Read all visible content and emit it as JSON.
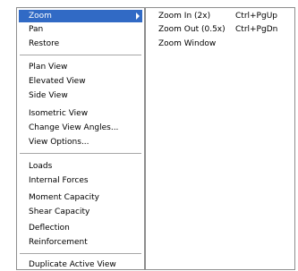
{
  "colors": {
    "selection_bg": "#316ac5",
    "selection_text": "#ffffff",
    "border": "#8e8e8e",
    "separator": "#a6a6a6"
  },
  "main_menu": {
    "items": [
      {
        "label": "Zoom",
        "has_submenu": true,
        "selected": true
      },
      {
        "label": "Pan"
      },
      {
        "label": "Restore"
      },
      {
        "label": "Plan View"
      },
      {
        "label": "Elevated View"
      },
      {
        "label": "Side View"
      },
      {
        "label": "Isometric View"
      },
      {
        "label": "Change View Angles..."
      },
      {
        "label": "View Options..."
      },
      {
        "label": "Loads"
      },
      {
        "label": "Internal Forces"
      },
      {
        "label": "Moment Capacity"
      },
      {
        "label": "Shear Capacity"
      },
      {
        "label": "Deflection"
      },
      {
        "label": "Reinforcement"
      },
      {
        "label": "Duplicate Active View"
      }
    ]
  },
  "zoom_submenu": {
    "items": [
      {
        "label": "Zoom In (2x)",
        "shortcut": "Ctrl+PgUp"
      },
      {
        "label": "Zoom Out (0.5x)",
        "shortcut": "Ctrl+PgDn"
      },
      {
        "label": "Zoom Window",
        "shortcut": ""
      }
    ]
  }
}
